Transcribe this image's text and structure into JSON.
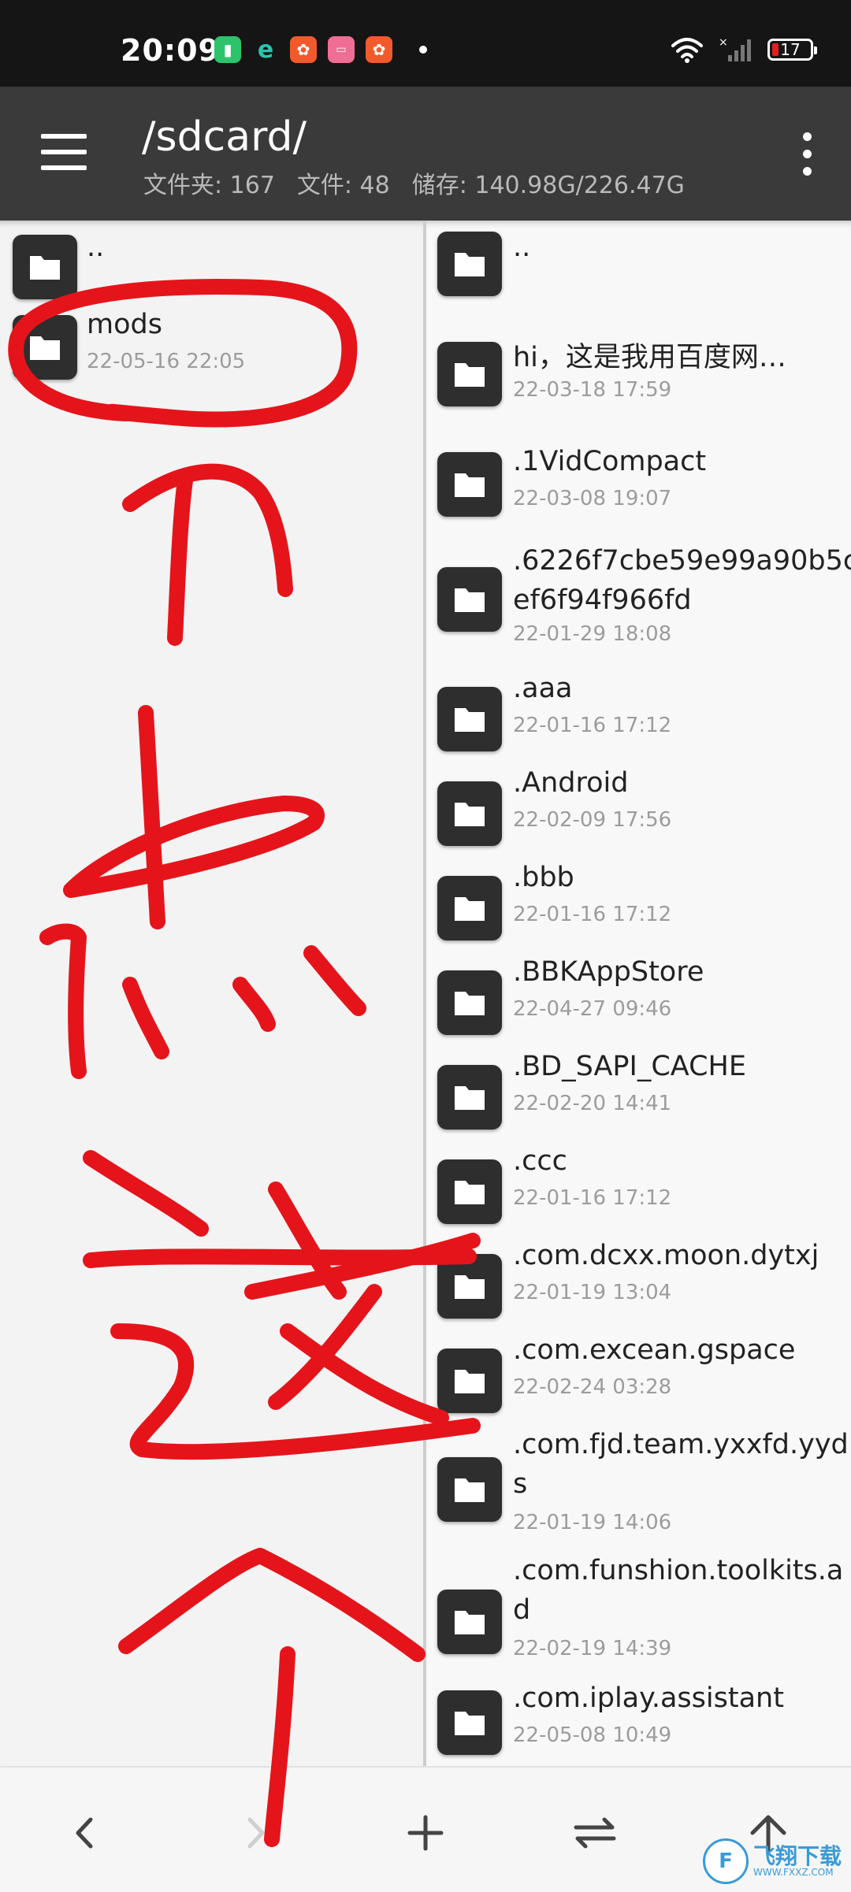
{
  "status_bar": {
    "time": "20:09",
    "battery_level": "17",
    "notification_icons": [
      "battery-saver-icon",
      "browser-e-icon",
      "kuaishou-icon",
      "bilibili-icon",
      "kuaishou-icon"
    ]
  },
  "app_bar": {
    "path": "/sdcard/",
    "folders_label": "文件夹: 167",
    "files_label": "文件: 48",
    "storage_label": "储存: 140.98G/226.47G"
  },
  "left_pane": {
    "items": [
      {
        "name": "..",
        "date": ""
      },
      {
        "name": "mods",
        "date": "22-05-16  22:05"
      }
    ]
  },
  "right_pane": {
    "items": [
      {
        "name": "..",
        "date": ""
      },
      {
        "name": "hi，这是我用百度网…",
        "date": "22-03-18  17:59"
      },
      {
        "name": ".1VidCompact",
        "date": "22-03-08  19:07"
      },
      {
        "name": ".6226f7cbe59e99a90b5c",
        "name2": "ef6f94f966fd",
        "date": "22-01-29  18:08"
      },
      {
        "name": ".aaa",
        "date": "22-01-16  17:12"
      },
      {
        "name": ".Android",
        "date": "22-02-09  17:56"
      },
      {
        "name": ".bbb",
        "date": "22-01-16  17:12"
      },
      {
        "name": ".BBKAppStore",
        "date": "22-04-27  09:46"
      },
      {
        "name": ".BD_SAPI_CACHE",
        "date": "22-02-20  14:41"
      },
      {
        "name": ".ccc",
        "date": "22-01-16  17:12"
      },
      {
        "name": ".com.dcxx.moon.dytxj",
        "date": "22-01-19  13:04"
      },
      {
        "name": ".com.excean.gspace",
        "date": "22-02-24  03:28"
      },
      {
        "name": ".com.fjd.team.yxxfd.yyd",
        "name2": "s",
        "date": "22-01-19  14:06"
      },
      {
        "name": ".com.funshion.toolkits.a",
        "name2": "d",
        "date": "22-02-19  14:39"
      },
      {
        "name": ".com.iplay.assistant",
        "date": "22-05-08  10:49"
      }
    ]
  },
  "bottom_bar": {
    "buttons": [
      "back-icon",
      "forward-icon",
      "add-icon",
      "swap-icon",
      "up-icon"
    ]
  },
  "annotation": {
    "handwritten_text": "点这个",
    "color": "#e5141b"
  },
  "watermark": {
    "cn": "飞翔下载",
    "en": "WWW.FXXZ.COM"
  }
}
